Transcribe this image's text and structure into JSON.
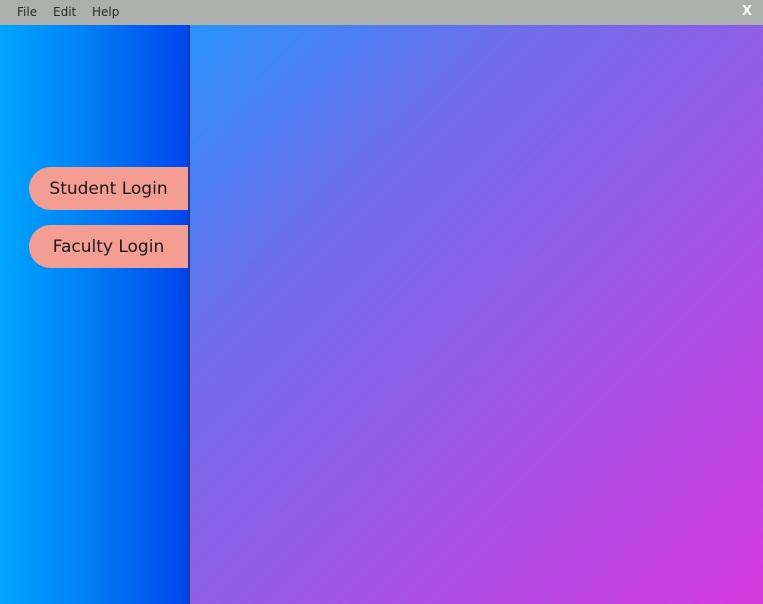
{
  "menubar": {
    "items": [
      "File",
      "Edit",
      "Help"
    ],
    "close_label": "X",
    "background": "#acb0ac"
  },
  "sidebar": {
    "buttons": [
      {
        "label": "Student Login"
      },
      {
        "label": "Faculty Login"
      }
    ],
    "gradient": [
      "#00a6fe",
      "#0046ec"
    ],
    "button_color": "#f49d92"
  },
  "main": {
    "gradient": [
      "#2892fc",
      "#9b59e5",
      "#d53adf"
    ]
  }
}
